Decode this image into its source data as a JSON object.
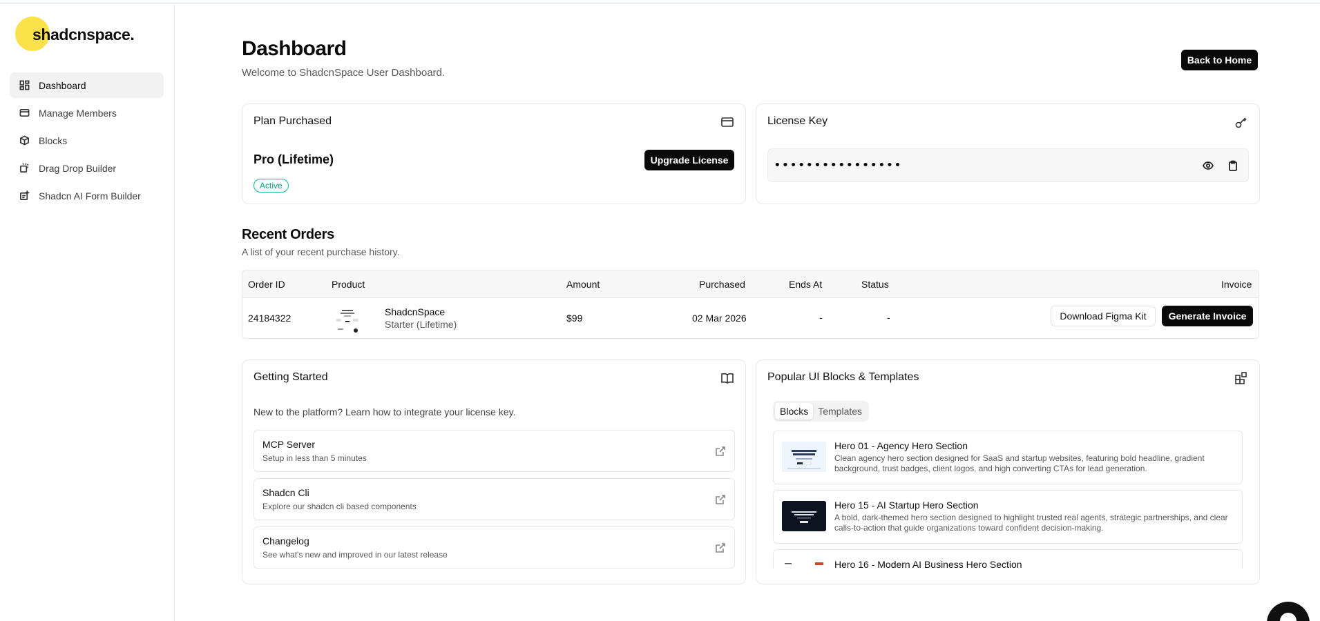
{
  "brand": {
    "name": "shadcnspace."
  },
  "sidebar": {
    "items": [
      {
        "label": "Dashboard",
        "icon": "grid-icon",
        "active": true
      },
      {
        "label": "Manage Members",
        "icon": "card-icon"
      },
      {
        "label": "Blocks",
        "icon": "box-icon"
      },
      {
        "label": "Drag Drop Builder",
        "icon": "drag-icon"
      },
      {
        "label": "Shadcn AI Form Builder",
        "icon": "form-icon"
      }
    ]
  },
  "header": {
    "title": "Dashboard",
    "subtitle": "Welcome to ShadcnSpace User Dashboard.",
    "back_label": "Back to Home"
  },
  "plan": {
    "title": "Plan Purchased",
    "name": "Pro (Lifetime)",
    "upgrade_label": "Upgrade License",
    "status": "Active"
  },
  "license": {
    "title": "License Key",
    "masked_value": "••••••••••••••••"
  },
  "orders": {
    "title": "Recent Orders",
    "subtitle": "A list of your recent purchase history.",
    "columns": [
      "Order ID",
      "Product",
      "Amount",
      "Purchased",
      "Ends At",
      "Status",
      "Invoice"
    ],
    "rows": [
      {
        "order_id": "24184322",
        "product_name": "ShadcnSpace",
        "product_plan": "Starter (Lifetime)",
        "amount": "$99",
        "purchased": "02 Mar 2026",
        "ends_at": "-",
        "status": "-",
        "download_label": "Download Figma Kit",
        "invoice_label": "Generate Invoice"
      }
    ]
  },
  "getting_started": {
    "title": "Getting Started",
    "subtitle": "New to the platform? Learn how to integrate your license key.",
    "items": [
      {
        "title": "MCP Server",
        "subtitle": "Setup in less than 5 minutes"
      },
      {
        "title": "Shadcn Cli",
        "subtitle": "Explore our shadcn cli based components"
      },
      {
        "title": "Changelog",
        "subtitle": "See what's new and improved in our latest release"
      }
    ]
  },
  "popular": {
    "title": "Popular UI Blocks & Templates",
    "tabs": [
      "Blocks",
      "Templates"
    ],
    "active_tab": "Blocks",
    "items": [
      {
        "title": "Hero 01 - Agency Hero Section",
        "description": "Clean agency hero section designed for SaaS and startup websites, featuring bold headline, gradient background, trust badges, client logos, and high converting CTAs for lead generation."
      },
      {
        "title": "Hero 15 - AI Startup Hero Section",
        "description": "A bold, dark-themed hero section designed to highlight trusted real agents, strategic partnerships, and clear calls-to-action that guide organizations toward confident decision-making."
      },
      {
        "title": "Hero 16 - Modern AI Business Hero Section",
        "description": ""
      }
    ]
  },
  "colors": {
    "accent_yellow": "#fbe24a",
    "active_badge": "#1fb5a0",
    "primary_button": "#0a0a0a"
  }
}
